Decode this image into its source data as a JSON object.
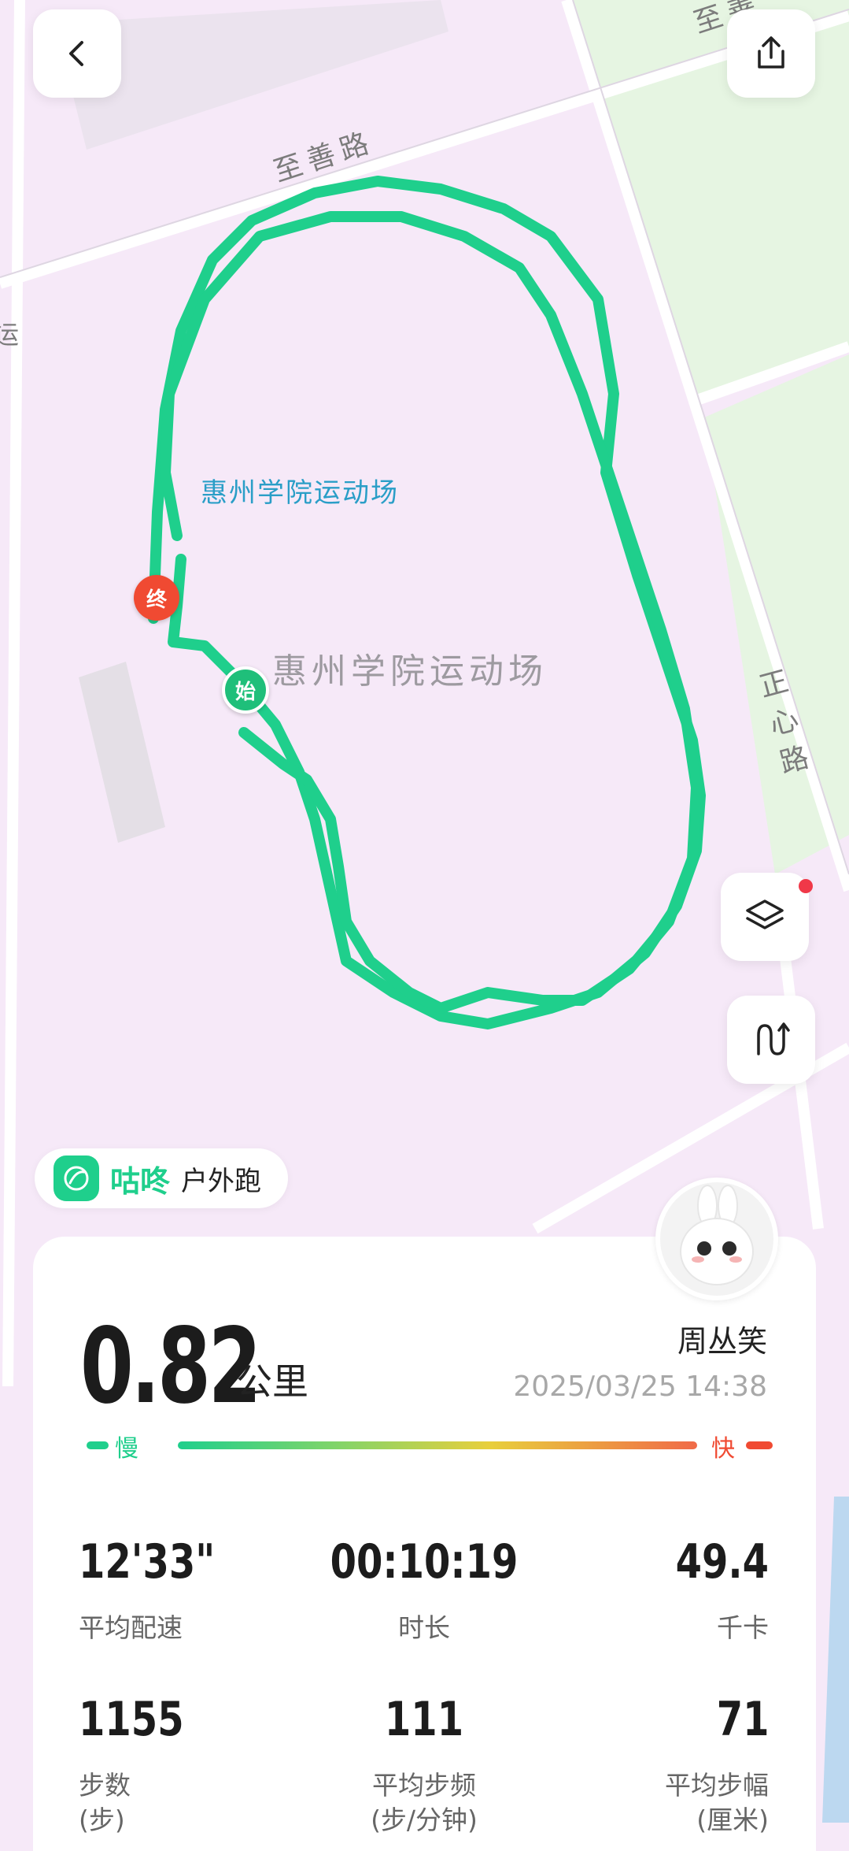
{
  "map": {
    "roads": {
      "north": "至善路",
      "east": "正心路",
      "west_fragment": "运",
      "northeast_fragment": "至善"
    },
    "venue_label_blue": "惠州学院运动场",
    "venue_label_grey": "惠州学院运动场",
    "start_marker": "始",
    "end_marker": "终",
    "colors": {
      "background": "#f6e9f8",
      "track": "#1fcf8c",
      "park": "#e8f6e6",
      "end_marker": "#f04a32",
      "start_marker": "#1fbf7a"
    }
  },
  "buttons": {
    "back_icon": "chevron-left-icon",
    "share_icon": "share-icon",
    "layers_icon": "layers-icon",
    "route_icon": "route-icon"
  },
  "brand": {
    "name": "咕咚",
    "activity": "户外跑"
  },
  "summary": {
    "distance": "0.82",
    "distance_unit": "公里",
    "user_name": "周丛笑",
    "datetime": "2025/03/25 14:38",
    "slow_label": "慢",
    "fast_label": "快"
  },
  "stats": [
    {
      "value": "12'33\"",
      "label": "平均配速"
    },
    {
      "value": "00:10:19",
      "label": "时长"
    },
    {
      "value": "49.4",
      "label": "千卡"
    },
    {
      "value": "1155",
      "label": "步数",
      "unit": "(步)"
    },
    {
      "value": "111",
      "label": "平均步频",
      "unit": "(步/分钟)"
    },
    {
      "value": "71",
      "label": "平均步幅",
      "unit": "(厘米)"
    }
  ]
}
